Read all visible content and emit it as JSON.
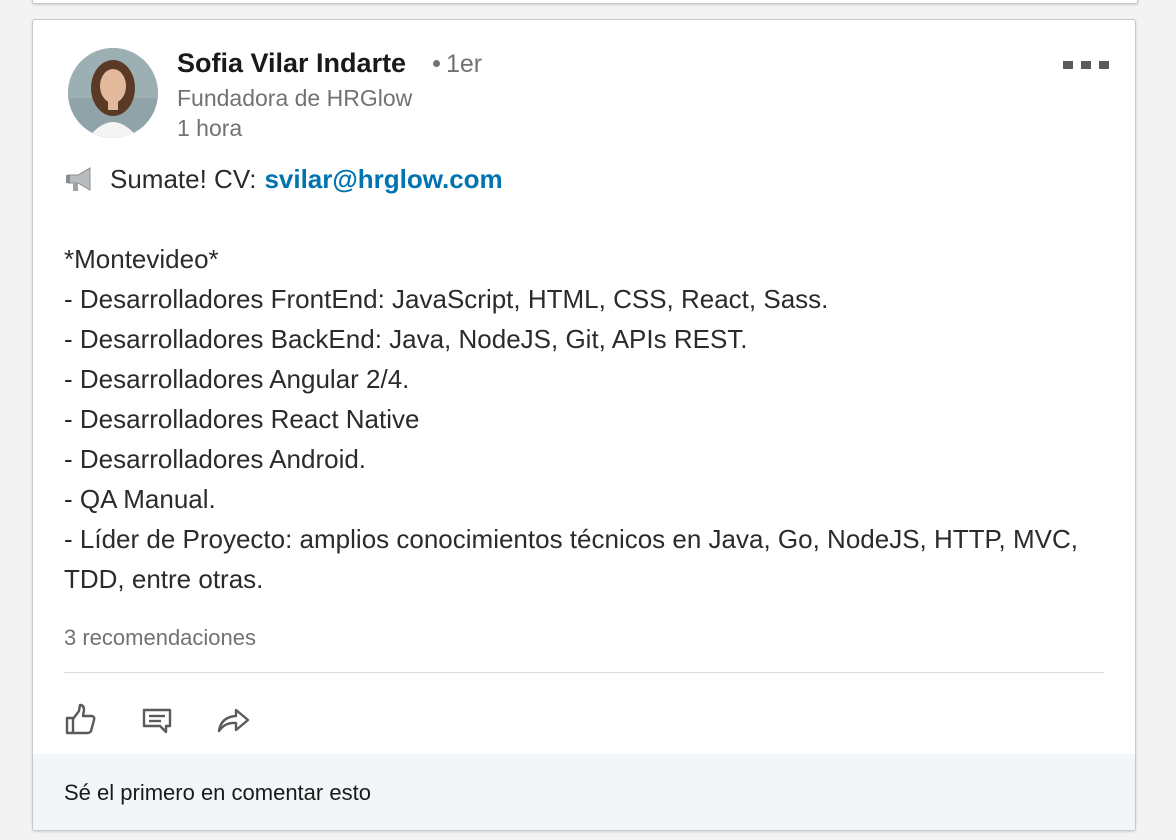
{
  "post": {
    "author": {
      "name": "Sofia Vilar Indarte",
      "degree": "1er",
      "headline": "Fundadora de HRGlow",
      "time": "1 hora"
    },
    "body": {
      "intro": "Sumate! CV:",
      "email": "svilar@hrglow.com",
      "lines": [
        "*Montevideo*",
        "- Desarrolladores FrontEnd: JavaScript, HTML, CSS, React, Sass.",
        "- Desarrolladores BackEnd: Java, NodeJS, Git, APIs REST.",
        "- Desarrolladores Angular 2/4.",
        "- Desarrolladores React Native",
        "- Desarrolladores Android.",
        "- QA Manual.",
        "- Líder de Proyecto: amplios conocimientos técnicos en Java, Go, NodeJS, HTTP, MVC, TDD, entre otras."
      ]
    },
    "recommendations": "3 recomendaciones",
    "comment_prompt": "Sé el primero en comentar esto"
  },
  "icons": {
    "more": "more-horizontal-icon",
    "megaphone": "megaphone-icon",
    "like": "thumbs-up-icon",
    "comment": "comment-icon",
    "share": "share-icon"
  },
  "colors": {
    "link": "#0073b1",
    "secondary_text": "#727272",
    "footer_bg": "#f3f6f8"
  }
}
